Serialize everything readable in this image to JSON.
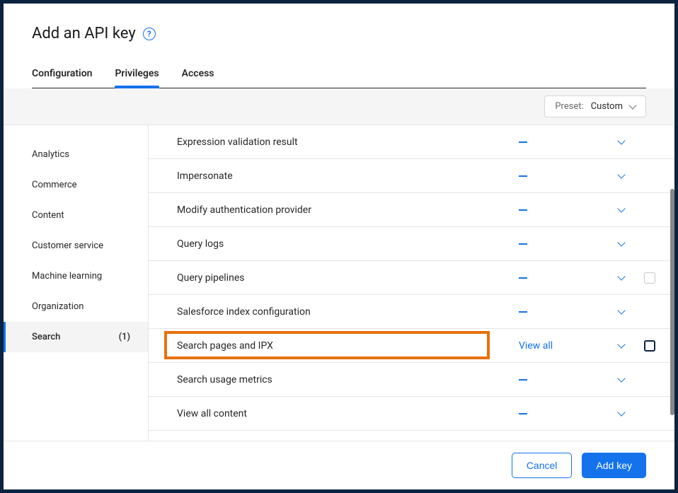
{
  "header": {
    "title": "Add an API key"
  },
  "tabs": [
    {
      "label": "Configuration",
      "active": false
    },
    {
      "label": "Privileges",
      "active": true
    },
    {
      "label": "Access",
      "active": false
    }
  ],
  "preset": {
    "label": "Preset:",
    "value": "Custom"
  },
  "sidebar": {
    "items": [
      {
        "label": "Analytics",
        "count": ""
      },
      {
        "label": "Commerce",
        "count": ""
      },
      {
        "label": "Content",
        "count": ""
      },
      {
        "label": "Customer service",
        "count": ""
      },
      {
        "label": "Machine learning",
        "count": ""
      },
      {
        "label": "Organization",
        "count": ""
      },
      {
        "label": "Search",
        "count": "(1)",
        "active": true
      }
    ]
  },
  "privileges": [
    {
      "label": "Expression validation result",
      "value": "—",
      "checkbox": false
    },
    {
      "label": "Impersonate",
      "value": "—",
      "checkbox": false
    },
    {
      "label": "Modify authentication provider",
      "value": "—",
      "checkbox": false
    },
    {
      "label": "Query logs",
      "value": "—",
      "checkbox": false
    },
    {
      "label": "Query pipelines",
      "value": "—",
      "checkbox": true,
      "checkboxStyle": "ghost"
    },
    {
      "label": "Salesforce index configuration",
      "value": "—",
      "checkbox": false
    },
    {
      "label": "Search pages and IPX",
      "value": "View all",
      "checkbox": true,
      "checkboxStyle": "annotation",
      "highlighted": true
    },
    {
      "label": "Search usage metrics",
      "value": "—",
      "checkbox": false
    },
    {
      "label": "View all content",
      "value": "—",
      "checkbox": false
    }
  ],
  "footer": {
    "cancel_label": "Cancel",
    "submit_label": "Add key"
  }
}
